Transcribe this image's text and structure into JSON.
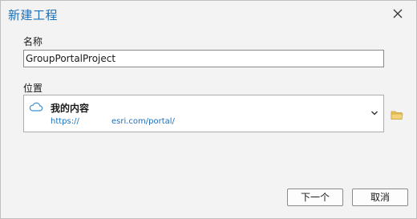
{
  "dialog": {
    "title": "新建工程",
    "close_icon": "close-icon"
  },
  "name_field": {
    "label": "名称",
    "value": "GroupPortalProject"
  },
  "location": {
    "label": "位置",
    "icon": "cloud-icon",
    "title": "我的内容",
    "url_prefix": "https://",
    "url_suffix": "esri.com/portal/",
    "dropdown_icon": "chevron-down-icon",
    "browse_icon": "folder-icon"
  },
  "buttons": {
    "next_label": "下一个",
    "cancel_label": "取消"
  },
  "colors": {
    "accent": "#1f6fb5",
    "folder": "#e8c15a"
  }
}
